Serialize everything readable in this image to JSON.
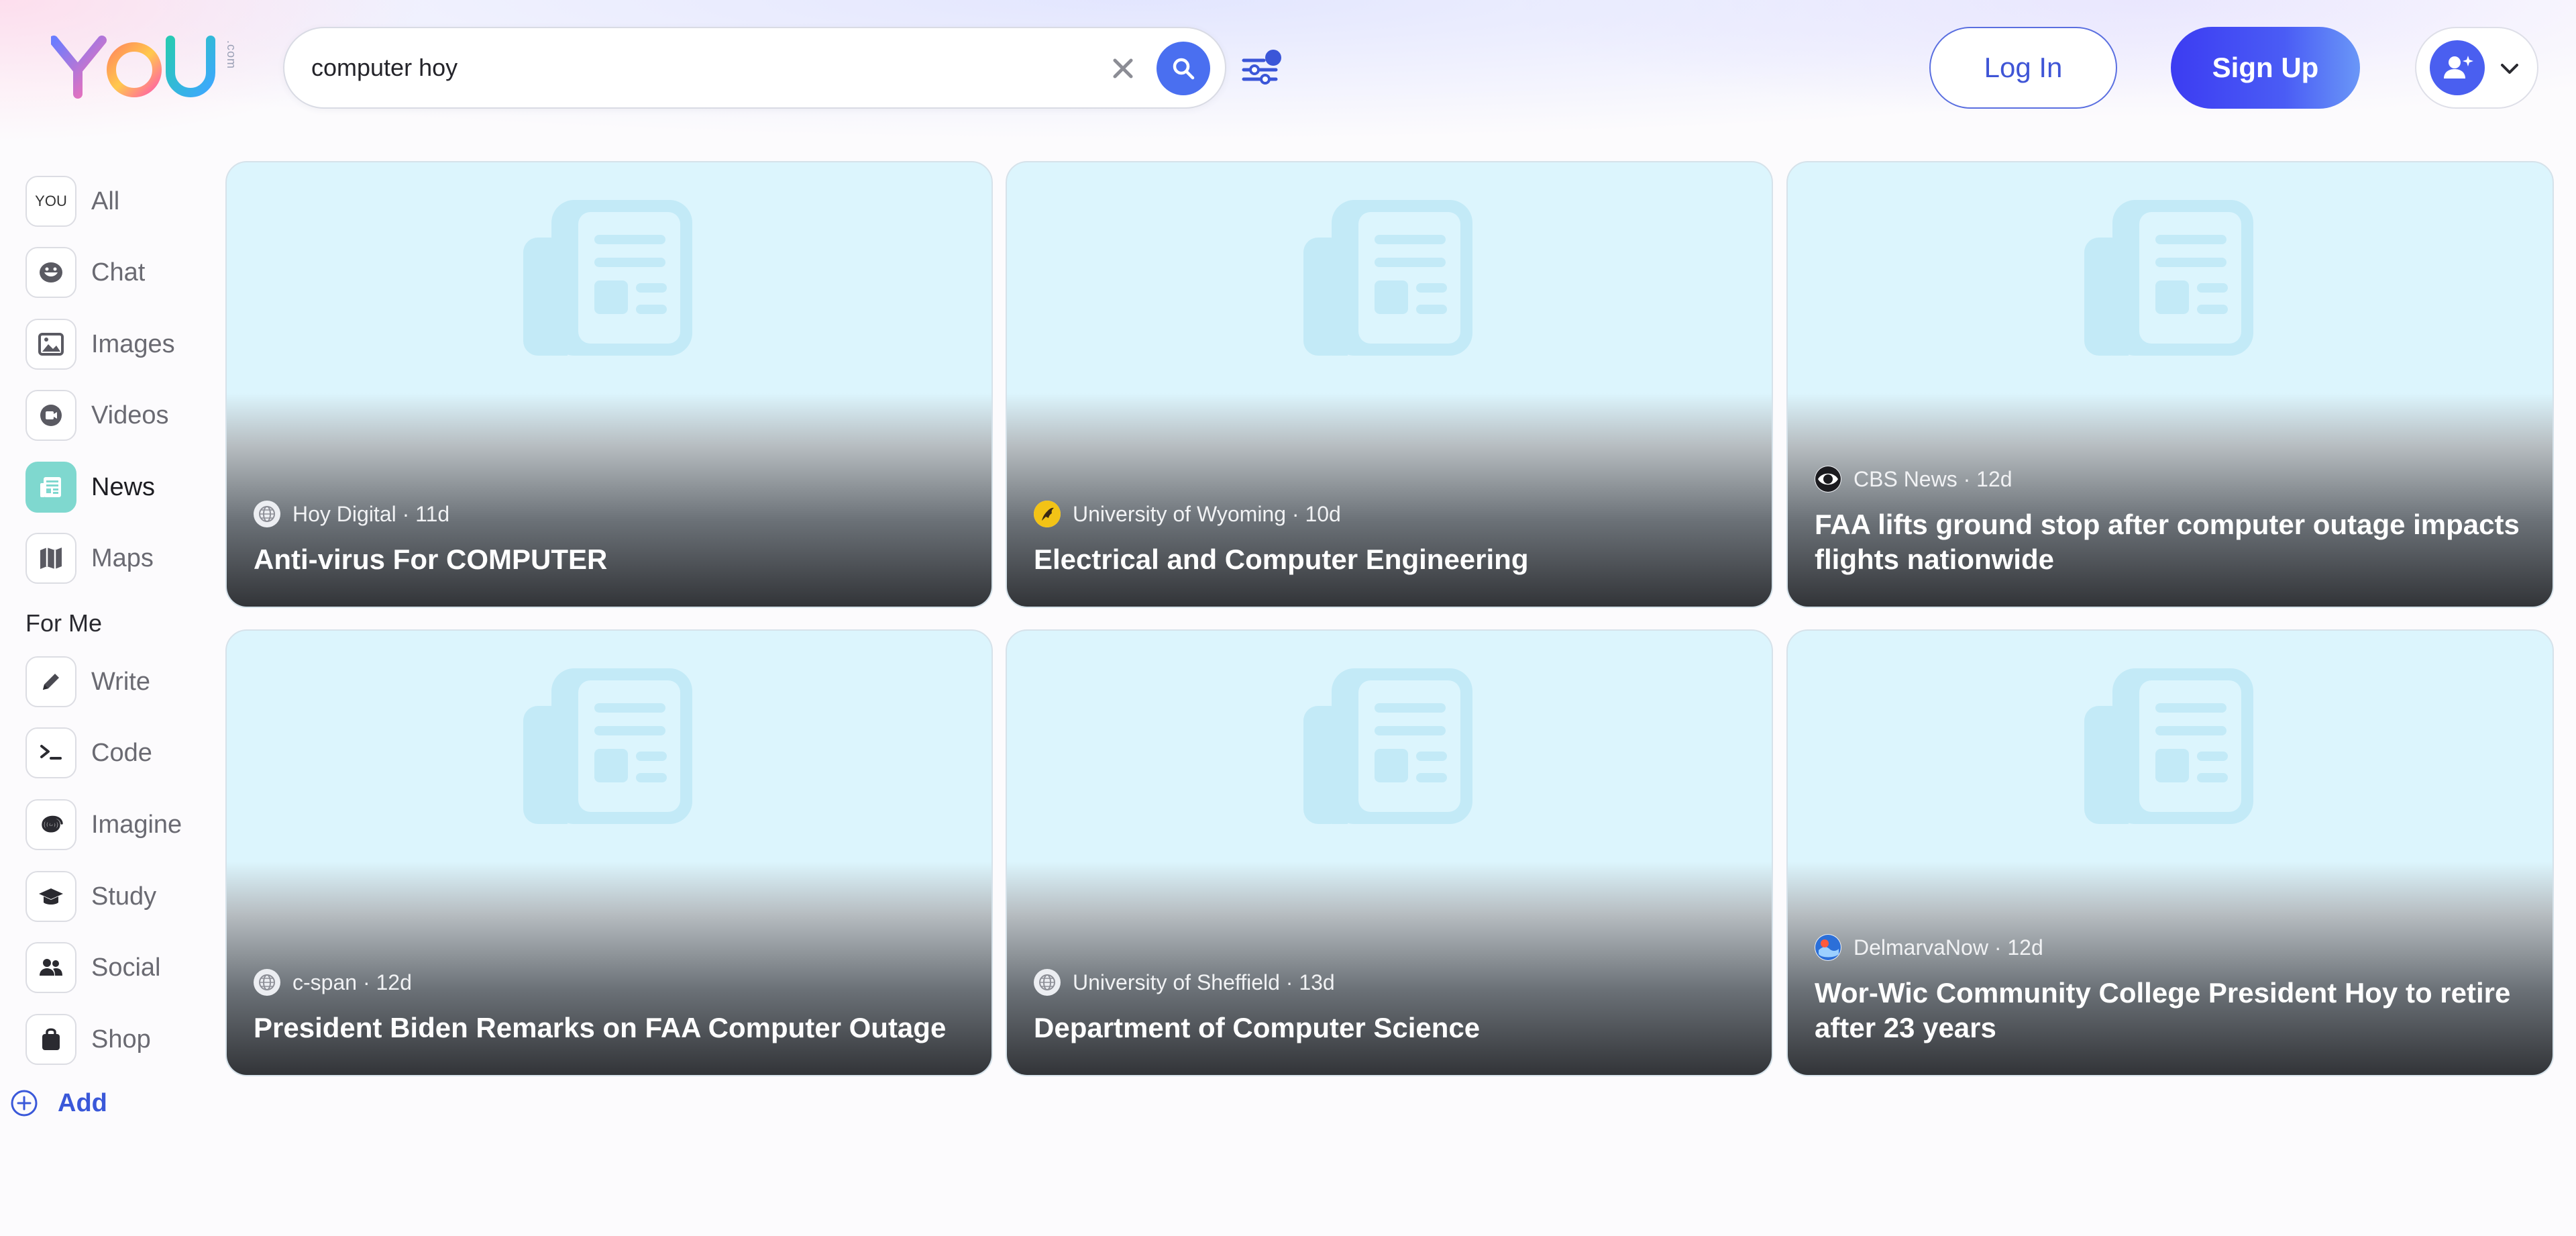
{
  "header": {
    "logo_text": "YOU",
    "logo_suffix": ".com",
    "search": {
      "value": "computer hoy",
      "placeholder": ""
    },
    "login_label": "Log In",
    "signup_label": "Sign Up"
  },
  "sidebar": {
    "items": [
      {
        "label": "All",
        "icon": "you-logo-icon",
        "active": false
      },
      {
        "label": "Chat",
        "icon": "chat-face-icon",
        "active": false
      },
      {
        "label": "Images",
        "icon": "image-icon",
        "active": false
      },
      {
        "label": "Videos",
        "icon": "video-icon",
        "active": false
      },
      {
        "label": "News",
        "icon": "newspaper-icon",
        "active": true
      },
      {
        "label": "Maps",
        "icon": "map-icon",
        "active": false
      }
    ],
    "section_label": "For Me",
    "apps": [
      {
        "label": "Write",
        "icon": "pencil-icon"
      },
      {
        "label": "Code",
        "icon": "terminal-icon"
      },
      {
        "label": "Imagine",
        "icon": "spiral-icon"
      },
      {
        "label": "Study",
        "icon": "graduation-cap-icon"
      },
      {
        "label": "Social",
        "icon": "people-icon"
      },
      {
        "label": "Shop",
        "icon": "shopping-bag-icon"
      }
    ],
    "add_label": "Add"
  },
  "news": [
    {
      "source": "Hoy Digital · 11d",
      "title": "Anti-virus For COMPUTER",
      "favicon": "globe-icon"
    },
    {
      "source": "University of Wyoming · 10d",
      "title": "Electrical and Computer Engineering",
      "favicon": "cowboy-logo-icon"
    },
    {
      "source": "CBS News · 12d",
      "title": "FAA lifts ground stop after computer outage impacts flights nationwide",
      "favicon": "cbs-eye-icon"
    },
    {
      "source": "c-span · 12d",
      "title": "President Biden Remarks on FAA Computer Outage",
      "favicon": "globe-icon"
    },
    {
      "source": "University of Sheffield · 13d",
      "title": "Department of Computer Science",
      "favicon": "globe-icon"
    },
    {
      "source": "DelmarvaNow · 12d",
      "title": "Wor-Wic Community College President Hoy to retire after 23 years",
      "favicon": "delmarva-icon"
    }
  ],
  "colors": {
    "accent": "#4a6ff0",
    "active_nav": "#7fd8cf",
    "card_bg": "#dcf5fd",
    "placeholder_icon": "#c3eaf7"
  }
}
